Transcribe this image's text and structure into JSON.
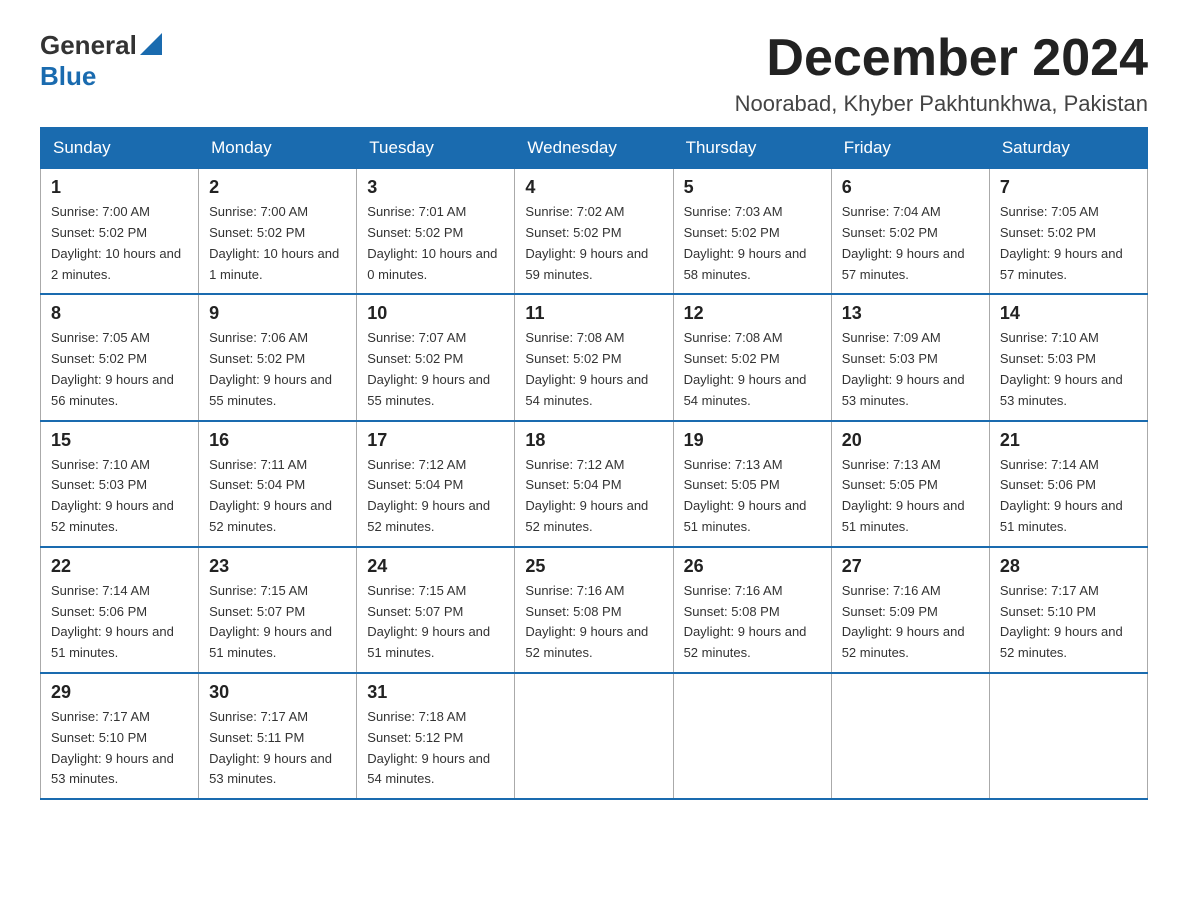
{
  "header": {
    "logo_general": "General",
    "logo_blue": "Blue",
    "month_title": "December 2024",
    "location": "Noorabad, Khyber Pakhtunkhwa, Pakistan"
  },
  "days_of_week": [
    "Sunday",
    "Monday",
    "Tuesday",
    "Wednesday",
    "Thursday",
    "Friday",
    "Saturday"
  ],
  "weeks": [
    [
      {
        "day": "1",
        "sunrise": "7:00 AM",
        "sunset": "5:02 PM",
        "daylight": "10 hours and 2 minutes."
      },
      {
        "day": "2",
        "sunrise": "7:00 AM",
        "sunset": "5:02 PM",
        "daylight": "10 hours and 1 minute."
      },
      {
        "day": "3",
        "sunrise": "7:01 AM",
        "sunset": "5:02 PM",
        "daylight": "10 hours and 0 minutes."
      },
      {
        "day": "4",
        "sunrise": "7:02 AM",
        "sunset": "5:02 PM",
        "daylight": "9 hours and 59 minutes."
      },
      {
        "day": "5",
        "sunrise": "7:03 AM",
        "sunset": "5:02 PM",
        "daylight": "9 hours and 58 minutes."
      },
      {
        "day": "6",
        "sunrise": "7:04 AM",
        "sunset": "5:02 PM",
        "daylight": "9 hours and 57 minutes."
      },
      {
        "day": "7",
        "sunrise": "7:05 AM",
        "sunset": "5:02 PM",
        "daylight": "9 hours and 57 minutes."
      }
    ],
    [
      {
        "day": "8",
        "sunrise": "7:05 AM",
        "sunset": "5:02 PM",
        "daylight": "9 hours and 56 minutes."
      },
      {
        "day": "9",
        "sunrise": "7:06 AM",
        "sunset": "5:02 PM",
        "daylight": "9 hours and 55 minutes."
      },
      {
        "day": "10",
        "sunrise": "7:07 AM",
        "sunset": "5:02 PM",
        "daylight": "9 hours and 55 minutes."
      },
      {
        "day": "11",
        "sunrise": "7:08 AM",
        "sunset": "5:02 PM",
        "daylight": "9 hours and 54 minutes."
      },
      {
        "day": "12",
        "sunrise": "7:08 AM",
        "sunset": "5:02 PM",
        "daylight": "9 hours and 54 minutes."
      },
      {
        "day": "13",
        "sunrise": "7:09 AM",
        "sunset": "5:03 PM",
        "daylight": "9 hours and 53 minutes."
      },
      {
        "day": "14",
        "sunrise": "7:10 AM",
        "sunset": "5:03 PM",
        "daylight": "9 hours and 53 minutes."
      }
    ],
    [
      {
        "day": "15",
        "sunrise": "7:10 AM",
        "sunset": "5:03 PM",
        "daylight": "9 hours and 52 minutes."
      },
      {
        "day": "16",
        "sunrise": "7:11 AM",
        "sunset": "5:04 PM",
        "daylight": "9 hours and 52 minutes."
      },
      {
        "day": "17",
        "sunrise": "7:12 AM",
        "sunset": "5:04 PM",
        "daylight": "9 hours and 52 minutes."
      },
      {
        "day": "18",
        "sunrise": "7:12 AM",
        "sunset": "5:04 PM",
        "daylight": "9 hours and 52 minutes."
      },
      {
        "day": "19",
        "sunrise": "7:13 AM",
        "sunset": "5:05 PM",
        "daylight": "9 hours and 51 minutes."
      },
      {
        "day": "20",
        "sunrise": "7:13 AM",
        "sunset": "5:05 PM",
        "daylight": "9 hours and 51 minutes."
      },
      {
        "day": "21",
        "sunrise": "7:14 AM",
        "sunset": "5:06 PM",
        "daylight": "9 hours and 51 minutes."
      }
    ],
    [
      {
        "day": "22",
        "sunrise": "7:14 AM",
        "sunset": "5:06 PM",
        "daylight": "9 hours and 51 minutes."
      },
      {
        "day": "23",
        "sunrise": "7:15 AM",
        "sunset": "5:07 PM",
        "daylight": "9 hours and 51 minutes."
      },
      {
        "day": "24",
        "sunrise": "7:15 AM",
        "sunset": "5:07 PM",
        "daylight": "9 hours and 51 minutes."
      },
      {
        "day": "25",
        "sunrise": "7:16 AM",
        "sunset": "5:08 PM",
        "daylight": "9 hours and 52 minutes."
      },
      {
        "day": "26",
        "sunrise": "7:16 AM",
        "sunset": "5:08 PM",
        "daylight": "9 hours and 52 minutes."
      },
      {
        "day": "27",
        "sunrise": "7:16 AM",
        "sunset": "5:09 PM",
        "daylight": "9 hours and 52 minutes."
      },
      {
        "day": "28",
        "sunrise": "7:17 AM",
        "sunset": "5:10 PM",
        "daylight": "9 hours and 52 minutes."
      }
    ],
    [
      {
        "day": "29",
        "sunrise": "7:17 AM",
        "sunset": "5:10 PM",
        "daylight": "9 hours and 53 minutes."
      },
      {
        "day": "30",
        "sunrise": "7:17 AM",
        "sunset": "5:11 PM",
        "daylight": "9 hours and 53 minutes."
      },
      {
        "day": "31",
        "sunrise": "7:18 AM",
        "sunset": "5:12 PM",
        "daylight": "9 hours and 54 minutes."
      },
      null,
      null,
      null,
      null
    ]
  ]
}
